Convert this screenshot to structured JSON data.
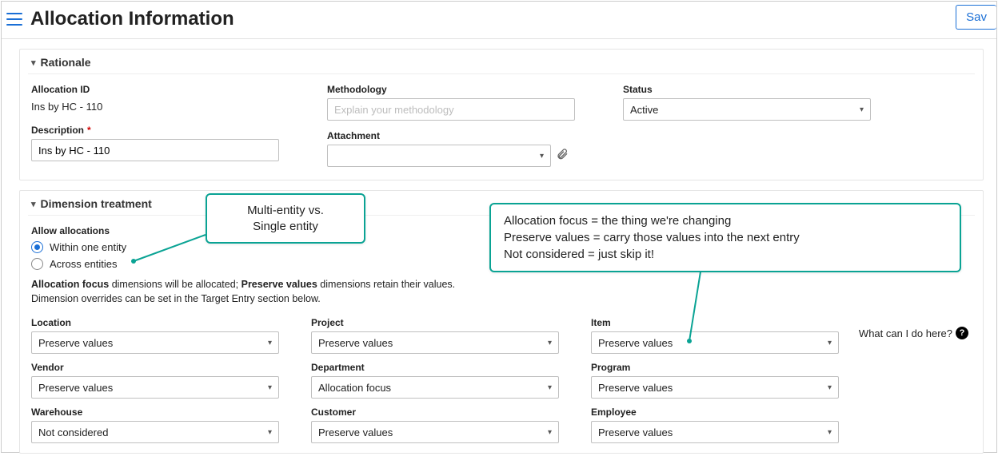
{
  "page": {
    "title": "Allocation Information",
    "save_button": "Sav"
  },
  "rationale": {
    "section_title": "Rationale",
    "allocation_id_label": "Allocation ID",
    "allocation_id_value": "Ins by HC - 110",
    "description_label": "Description",
    "description_value": "Ins by HC - 110",
    "methodology_label": "Methodology",
    "methodology_placeholder": "Explain your methodology",
    "attachment_label": "Attachment",
    "attachment_value": "",
    "status_label": "Status",
    "status_value": "Active"
  },
  "dimension": {
    "section_title": "Dimension treatment",
    "allow_label": "Allow allocations",
    "radio_within": "Within one entity",
    "radio_across": "Across entities",
    "help_text_1a": "Allocation focus",
    "help_text_1b": " dimensions will be allocated; ",
    "help_text_1c": "Preserve values",
    "help_text_1d": " dimensions retain their values.",
    "help_text_2": "Dimension overrides can be set in the Target Entry section below.",
    "what_can_i_do": "What can I do here?",
    "fields": {
      "location": {
        "label": "Location",
        "value": "Preserve values"
      },
      "vendor": {
        "label": "Vendor",
        "value": "Preserve values"
      },
      "warehouse": {
        "label": "Warehouse",
        "value": "Not considered"
      },
      "project": {
        "label": "Project",
        "value": "Preserve values"
      },
      "department": {
        "label": "Department",
        "value": "Allocation focus"
      },
      "customer": {
        "label": "Customer",
        "value": "Preserve values"
      },
      "item": {
        "label": "Item",
        "value": "Preserve values"
      },
      "program": {
        "label": "Program",
        "value": "Preserve values"
      },
      "employee": {
        "label": "Employee",
        "value": "Preserve values"
      }
    }
  },
  "callouts": {
    "c1_line1": "Multi-entity vs.",
    "c1_line2": "Single entity",
    "c2_line1": "Allocation focus = the thing we're changing",
    "c2_line2": "Preserve values = carry those values into the next entry",
    "c2_line3": "Not considered = just skip it!"
  }
}
